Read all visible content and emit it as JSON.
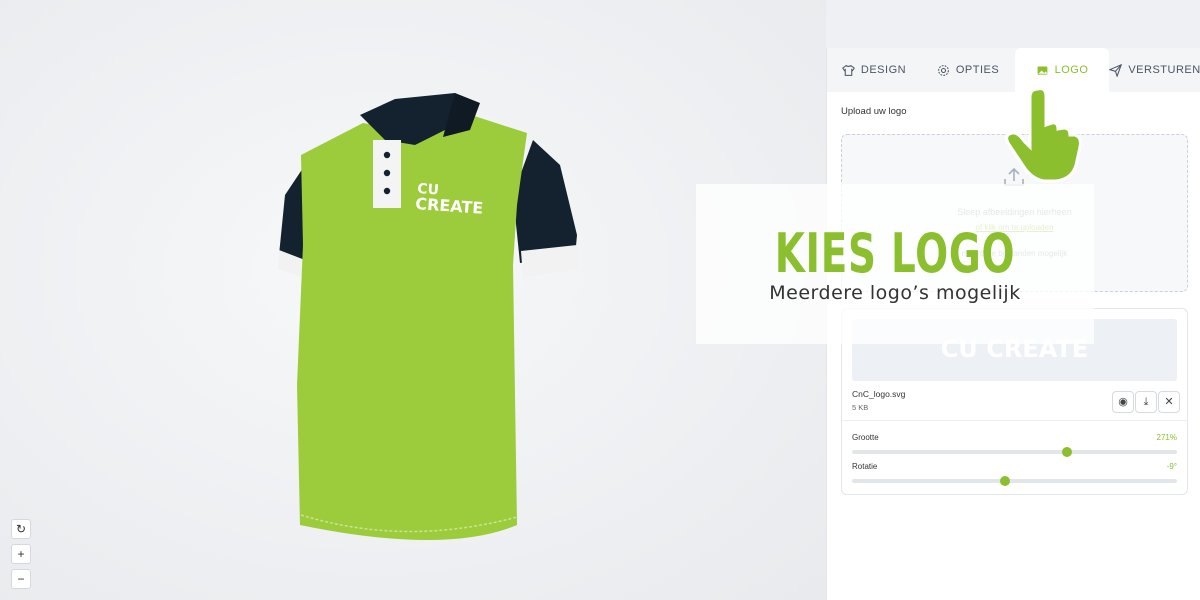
{
  "tabs": [
    {
      "label": "DESIGN",
      "icon": "shirt-icon"
    },
    {
      "label": "OPTIES",
      "icon": "gear-icon"
    },
    {
      "label": "LOGO",
      "icon": "image-icon"
    },
    {
      "label": "VERSTUREN",
      "icon": "send-icon"
    }
  ],
  "upload": {
    "title": "Upload uw logo",
    "drop_text": "Sleep afbeeldingen hierheen",
    "link_text": "of klik om te uploaden",
    "note": "meerdere bestanden mogelijk"
  },
  "file": {
    "preview_brand": "CU CREATE",
    "name": "CnC_logo.svg",
    "size": "5 KB"
  },
  "settings": {
    "size_label": "Grootte",
    "size_value": "271%",
    "size_fraction": 0.66,
    "rotation_label": "Rotatie",
    "rotation_value": "-9°",
    "rotation_fraction": 0.47
  },
  "shirt": {
    "logo_line1": "CU",
    "logo_line2": "CREATE",
    "body_color": "#9ccb3b",
    "collar_color": "#14222f"
  },
  "overlay": {
    "headline": "KIES LOGO",
    "subline": "Meerdere logo’s mogelijk"
  },
  "viewer": {
    "reset_icon": "↻",
    "zoom_in": "+",
    "zoom_out": "−"
  },
  "colors": {
    "accent": "#8bbf2d"
  }
}
